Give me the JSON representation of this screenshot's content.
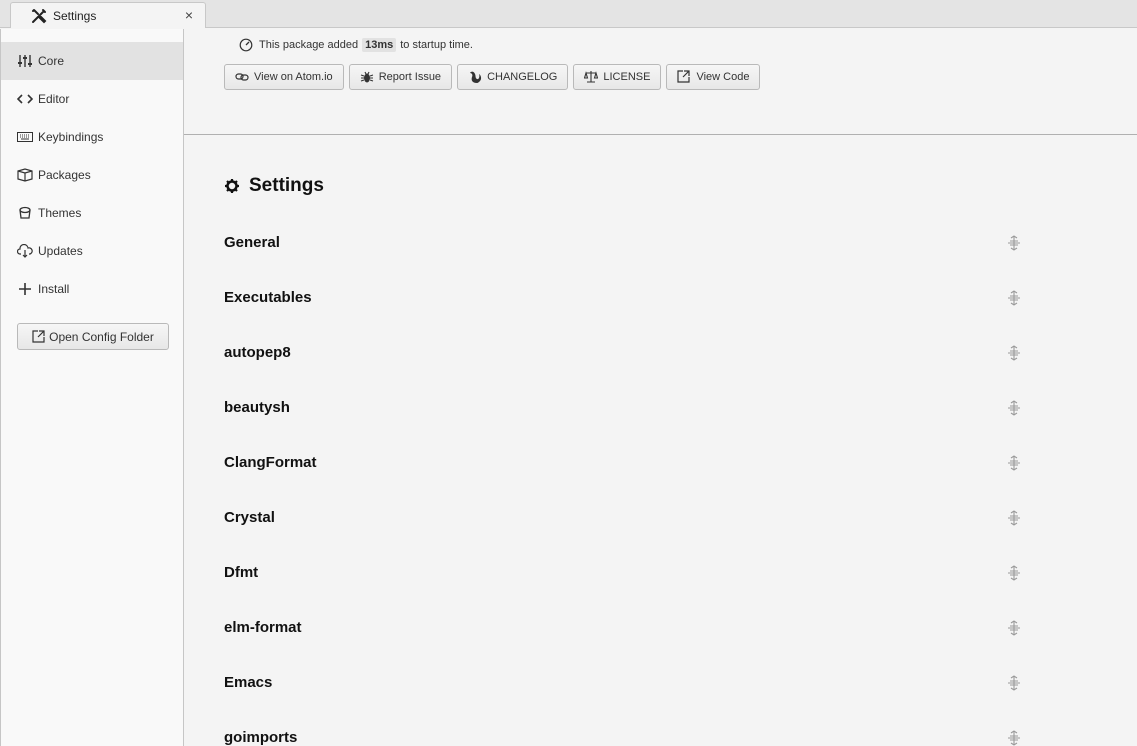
{
  "tab": {
    "title": "Settings",
    "close": "×"
  },
  "sidebar": {
    "items": [
      {
        "label": "Core",
        "icon": "sliders-icon",
        "active": true
      },
      {
        "label": "Editor",
        "icon": "code-icon"
      },
      {
        "label": "Keybindings",
        "icon": "keyboard-icon"
      },
      {
        "label": "Packages",
        "icon": "package-icon"
      },
      {
        "label": "Themes",
        "icon": "paintcan-icon"
      },
      {
        "label": "Updates",
        "icon": "cloud-download-icon"
      },
      {
        "label": "Install",
        "icon": "plus-icon"
      }
    ],
    "config_button": "Open Config Folder"
  },
  "package": {
    "startup_prefix": "This package added",
    "startup_ms": "13ms",
    "startup_suffix": "to startup time.",
    "buttons": [
      {
        "label": "View on Atom.io",
        "icon": "link-icon"
      },
      {
        "label": "Report Issue",
        "icon": "bug-icon"
      },
      {
        "label": "CHANGELOG",
        "icon": "squirrel-icon"
      },
      {
        "label": "LICENSE",
        "icon": "law-icon"
      },
      {
        "label": "View Code",
        "icon": "link-external-icon"
      }
    ]
  },
  "settings": {
    "heading": "Settings",
    "sections": [
      "General",
      "Executables",
      "autopep8",
      "beautysh",
      "ClangFormat",
      "Crystal",
      "Dfmt",
      "elm-format",
      "Emacs",
      "goimports"
    ]
  }
}
